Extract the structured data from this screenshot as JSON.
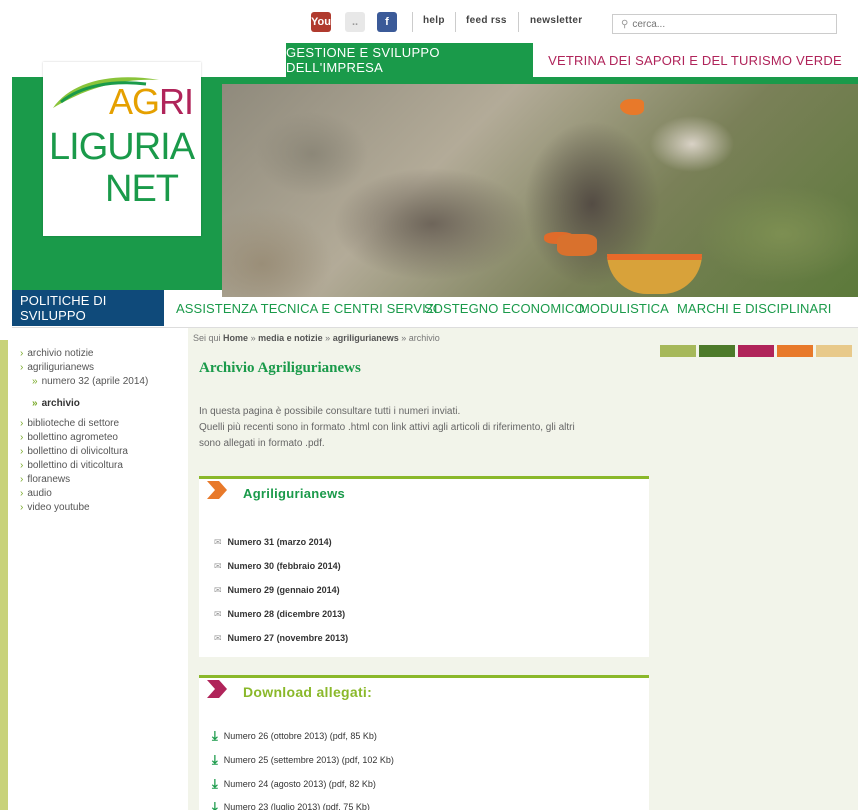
{
  "topbar": {
    "social": {
      "youtube": "You",
      "flickr": "..",
      "facebook": "f"
    },
    "links": [
      "help",
      "feed rss",
      "newsletter"
    ],
    "search_placeholder": "cerca..."
  },
  "sections": {
    "tab_active": "GESTIONE E SVILUPPO DELL'IMPRESA",
    "tab_other": "VETRINA DEI SAPORI E DEL TURISMO VERDE"
  },
  "logo": {
    "agri_a": "AG",
    "agri_b": "RI",
    "liguria": "LIGURIA",
    "net": "NET"
  },
  "nav": [
    "POLITICHE DI SVILUPPO",
    "ASSISTENZA TECNICA E CENTRI SERVIZI",
    "SOSTEGNO ECONOMICO",
    "MODULISTICA",
    "MARCHI E DISCIPLINARI"
  ],
  "breadcrumb": {
    "prefix": "Sei qui",
    "home": "Home",
    "sep": "»",
    "media": "media e notizie",
    "agri": "agriligurianews",
    "current": "archivio"
  },
  "sidebar": {
    "items": [
      "archivio notizie",
      "agriligurianews",
      "numero 32 (aprile 2014)",
      "archivio",
      "biblioteche di settore",
      "bollettino agrometeo",
      "bollettino di olivicoltura",
      "bollettino di viticoltura",
      "floranews",
      "audio",
      "video youtube"
    ]
  },
  "swatches": [
    "#a6b85a",
    "#4d7a2a",
    "#b0245a",
    "#e8792a",
    "#e8c98a"
  ],
  "page": {
    "title": "Archivio Agriligurianews",
    "intro1": "In questa pagina è possibile consultare tutti i numeri inviati.",
    "intro2": "Quelli più recenti sono in formato .html con link attivi agli articoli di riferimento, gli altri",
    "intro3": "sono allegati in formato .pdf."
  },
  "box1": {
    "title": "Agriligurianews",
    "items": [
      "Numero 31 (marzo 2014)",
      "Numero 30 (febbraio 2014)",
      "Numero 29 (gennaio 2014)",
      "Numero 28 (dicembre 2013)",
      "Numero 27 (novembre 2013)"
    ]
  },
  "box2": {
    "title": "Download allegati:",
    "items": [
      "Numero 26 (ottobre 2013) (pdf, 85 Kb)",
      "Numero 25 (settembre 2013) (pdf, 102 Kb)",
      "Numero 24 (agosto 2013) (pdf, 82 Kb)",
      "Numero 23 (luglio 2013) (pdf, 75 Kb)"
    ]
  }
}
